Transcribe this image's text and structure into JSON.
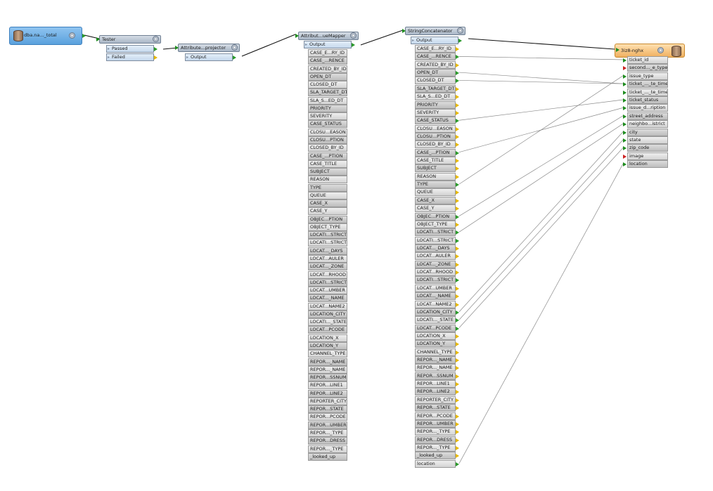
{
  "reader": {
    "label": "dba.na..._total"
  },
  "tester": {
    "title": "Tester",
    "ports": [
      "Passed",
      "Failed"
    ]
  },
  "projector": {
    "title": "Attribute...projector",
    "ports": [
      "Output"
    ]
  },
  "renamer": {
    "title": "Attribut...ueMapper",
    "output": "Output",
    "attrs": [
      "CASE_E...RY_ID",
      "CASE_...RENCE",
      "CREATED_BY_ID",
      "OPEN_DT",
      "CLOSED_DT",
      "SLA_TARGET_DT",
      "SLA_S...ED_DT",
      "PRIORITY",
      "SEVERITY",
      "CASE_STATUS",
      "CLOSU...EASON",
      "CLOSU...PTION",
      "CLOSED_BY_ID",
      "CASE_...PTION",
      "CASE_TITLE",
      "SUBJECT",
      "REASON",
      "TYPE",
      "QUEUE",
      "CASE_X",
      "CASE_Y",
      "OBJEC...PTION",
      "OBJECT_TYPE",
      "LOCATI...STRICT",
      "LOCATI...STRICT",
      "LOCAT..._DAYS",
      "LOCAT...AULER",
      "LOCAT..._ZONE",
      "LOCAT...RHOOD",
      "LOCATI...STRICT",
      "LOCAT...UMBER",
      "LOCAT..._NAME",
      "LOCAT...NAME2",
      "LOCATION_CITY",
      "LOCATI..._STATE",
      "LOCAT...PCODE",
      "LOCATION_X",
      "LOCATION_Y",
      "CHANNEL_TYPE",
      "REPOR..._NAME",
      "REPOR..._NAME",
      "REPOR...SSNUM",
      "REPOR...LINE1",
      "REPOR...LINE2",
      "REPORTER_CITY",
      "REPOR...STATE",
      "REPOR...PCODE",
      "REPOR...UMBER",
      "REPOR..._TYPE",
      "REPOR...DRESS",
      "REPOR..._TYPE",
      "_looked_up"
    ]
  },
  "concat": {
    "title": "StringConcatenator",
    "output": "Output",
    "attrs": [
      "CASE_E...RY_ID",
      "CASE_...RENCE",
      "CREATED_BY_ID",
      "OPEN_DT",
      "CLOSED_DT",
      "SLA_TARGET_DT",
      "SLA_S...ED_DT",
      "PRIORITY",
      "SEVERITY",
      "CASE_STATUS",
      "CLOSU...EASON",
      "CLOSU...PTION",
      "CLOSED_BY_ID",
      "CASE_...PTION",
      "CASE_TITLE",
      "SUBJECT",
      "REASON",
      "TYPE",
      "QUEUE",
      "CASE_X",
      "CASE_Y",
      "OBJEC...PTION",
      "OBJECT_TYPE",
      "LOCATI...STRICT",
      "LOCATI...STRICT",
      "LOCAT..._DAYS",
      "LOCAT...AULER",
      "LOCAT..._ZONE",
      "LOCAT...RHOOD",
      "LOCATI...STRICT",
      "LOCAT...UMBER",
      "LOCAT..._NAME",
      "LOCAT...NAME2",
      "LOCATION_CITY",
      "LOCATI..._STATE",
      "LOCAT...PCODE",
      "LOCATION_X",
      "LOCATION_Y",
      "CHANNEL_TYPE",
      "REPOR..._NAME",
      "REPOR..._NAME",
      "REPOR...SSNUM",
      "REPOR...LINE1",
      "REPOR...LINE2",
      "REPORTER_CITY",
      "REPOR...STATE",
      "REPOR...PCODE",
      "REPOR...UMBER",
      "REPOR..._TYPE",
      "REPOR...DRESS",
      "REPOR..._TYPE",
      "_looked_up",
      "location"
    ]
  },
  "writer": {
    "title": "3iz8-nghx",
    "attrs": [
      {
        "label": "ticket_id",
        "pin": "green"
      },
      {
        "label": "second..._e_type",
        "pin": "red"
      },
      {
        "label": "issue_type",
        "pin": "green"
      },
      {
        "label": "ticket_..._te_time",
        "pin": "green"
      },
      {
        "label": "ticket_..._te_time",
        "pin": "green"
      },
      {
        "label": "ticket_status",
        "pin": "green"
      },
      {
        "label": "issue_d...ription",
        "pin": "green"
      },
      {
        "label": "street_address",
        "pin": "green"
      },
      {
        "label": "neighbo...istrict",
        "pin": "green"
      },
      {
        "label": "city",
        "pin": "green"
      },
      {
        "label": "state",
        "pin": "green"
      },
      {
        "label": "zip_code",
        "pin": "green"
      },
      {
        "label": "image",
        "pin": "red"
      },
      {
        "label": "location",
        "pin": "green"
      }
    ]
  },
  "connections": [
    {
      "from": "CASE_...RENCE",
      "to": "ticket_id"
    },
    {
      "from": "OPEN_DT",
      "to": "ticket_..._te_time"
    },
    {
      "from": "CLOSED_DT",
      "to": "ticket_..._te_time"
    },
    {
      "from": "CASE_STATUS",
      "to": "ticket_status"
    },
    {
      "from": "CASE_...PTION",
      "to": "issue_d...ription"
    },
    {
      "from": "TYPE",
      "to": "issue_type"
    },
    {
      "from": "OBJEC...PTION",
      "to": "street_address"
    },
    {
      "from": "LOCATI...STRICT",
      "to": "neighbo...istrict"
    },
    {
      "from": "LOCATION_CITY",
      "to": "city"
    },
    {
      "from": "LOCATI..._STATE",
      "to": "state"
    },
    {
      "from": "LOCAT...PCODE",
      "to": "zip_code"
    },
    {
      "from": "location",
      "to": "location"
    }
  ]
}
